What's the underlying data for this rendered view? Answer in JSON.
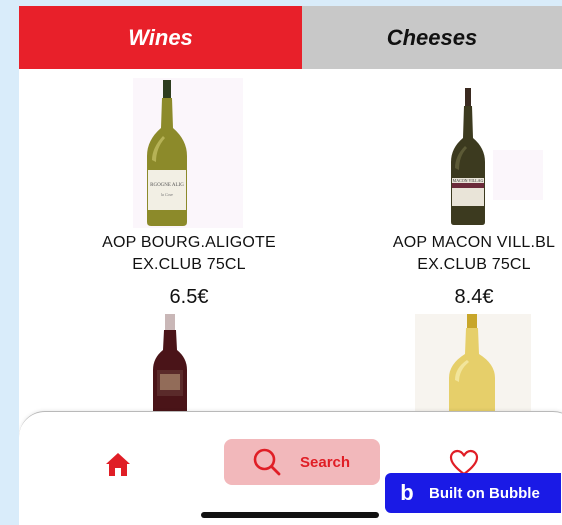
{
  "tabs": [
    {
      "label": "Wines",
      "active": true
    },
    {
      "label": "Cheeses",
      "active": false
    }
  ],
  "products": [
    {
      "name_line1": "AOP BOURG.ALIGOTE",
      "name_line2": "EX.CLUB 75CL",
      "price": "6.5€"
    },
    {
      "name_line1": "AOP MACON VILL.BL",
      "name_line2": "EX.CLUB 75CL",
      "price": "8.4€"
    }
  ],
  "nav": {
    "search_label": "Search",
    "home_icon": "home-icon",
    "search_icon": "search-icon",
    "heart_icon": "heart-icon"
  },
  "badge": {
    "logo": "b",
    "text": "Built on Bubble"
  },
  "colors": {
    "accent": "#e8202a",
    "tab_inactive": "#c8c8c8",
    "search_bg": "#f2b8bb",
    "bubble_blue": "#1a1ae6",
    "page_bg": "#d9ecfa"
  }
}
